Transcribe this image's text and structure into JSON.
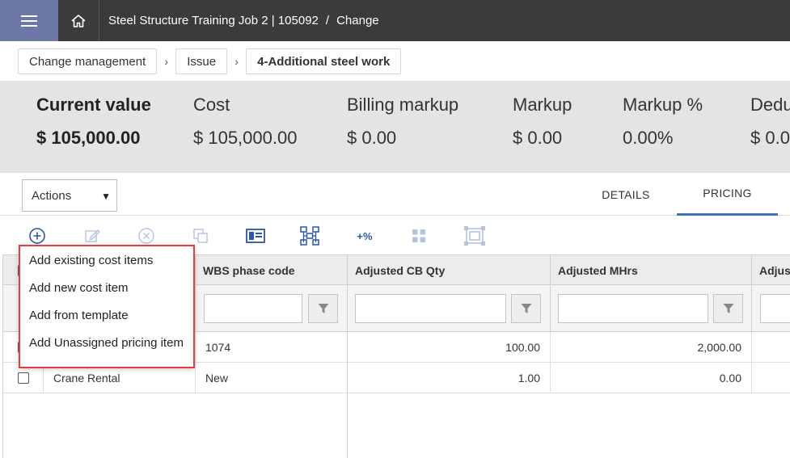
{
  "topbar": {
    "menu_icon": "hamburger-icon",
    "home_icon": "home-icon",
    "job_title": "Steel Structure Training Job 2 | 105092",
    "separator": "/",
    "page": "Change"
  },
  "breadcrumb": {
    "items": [
      "Change management",
      "Issue",
      "4-Additional steel work"
    ],
    "chevron": "›"
  },
  "summary": {
    "metrics": [
      {
        "label": "Current value",
        "value": "$ 105,000.00"
      },
      {
        "label": "Cost",
        "value": "$ 105,000.00"
      },
      {
        "label": "Billing markup",
        "value": "$ 0.00"
      },
      {
        "label": "Markup",
        "value": "$ 0.00"
      },
      {
        "label": "Markup %",
        "value": "0.00%"
      },
      {
        "label": "Dedu",
        "value": "$ 0.0"
      }
    ]
  },
  "actions": {
    "label": "Actions",
    "caret": "▼"
  },
  "tabs": [
    {
      "label": "DETAILS",
      "active": false
    },
    {
      "label": "PRICING",
      "active": true
    }
  ],
  "toolbar": {
    "icons": [
      "add-circle-icon",
      "edit-icon",
      "cancel-circle-icon",
      "copy-icon",
      "card-view-icon",
      "hierarchy-icon",
      "percent-markup-icon",
      "grid-icon",
      "fit-frame-icon"
    ],
    "percent_label": "+%"
  },
  "dropdown": {
    "items": [
      "Add existing cost items",
      "Add new cost item",
      "Add from template",
      "Add Unassigned pricing item"
    ]
  },
  "grid": {
    "columns": [
      "WBS phase code",
      "Adjusted CB Qty",
      "Adjusted MHrs",
      "Adjus"
    ],
    "rows": [
      {
        "description": "",
        "wbs": "1074",
        "cb_qty": "100.00",
        "mhrs": "2,000.00"
      },
      {
        "description": "Crane Rental",
        "wbs": "New",
        "cb_qty": "1.00",
        "mhrs": "0.00"
      }
    ]
  },
  "colors": {
    "topbar": "#3b3b3b",
    "menu_button": "#6d78a8",
    "summary_band": "#e4e4e4",
    "tab_accent": "#3f72b9",
    "highlight": "#e53c3c"
  }
}
